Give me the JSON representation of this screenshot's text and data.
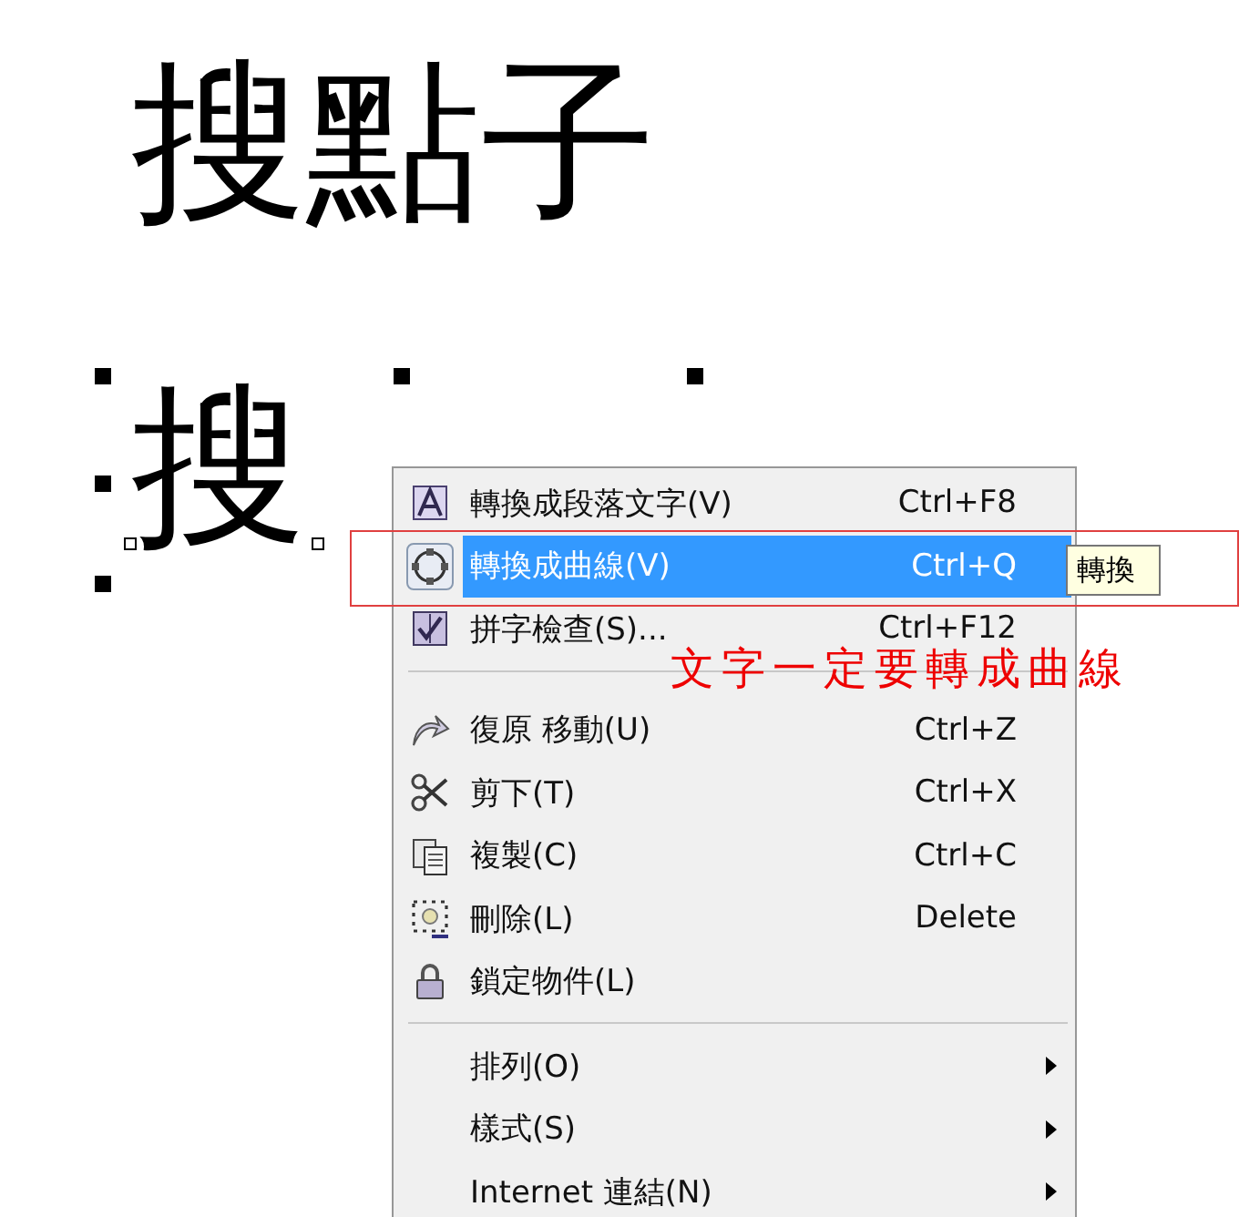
{
  "canvas_texts": [
    "搜點子",
    "搜"
  ],
  "context_menu": {
    "items": [
      {
        "kind": "item",
        "label": "轉換成段落文字(V)",
        "shortcut": "Ctrl+F8",
        "selected": false
      },
      {
        "kind": "item",
        "label": "轉換成曲線(V)",
        "shortcut": "Ctrl+Q",
        "selected": true
      },
      {
        "kind": "item",
        "label": "拼字檢查(S)...",
        "shortcut": "Ctrl+F12",
        "selected": false
      },
      {
        "kind": "separator"
      },
      {
        "kind": "item",
        "label": "復原 移動(U)",
        "shortcut": "Ctrl+Z",
        "selected": false
      },
      {
        "kind": "item",
        "label": "剪下(T)",
        "shortcut": "Ctrl+X",
        "selected": false
      },
      {
        "kind": "item",
        "label": "複製(C)",
        "shortcut": "Ctrl+C",
        "selected": false
      },
      {
        "kind": "item",
        "label": "刪除(L)",
        "shortcut": "Delete",
        "selected": false
      },
      {
        "kind": "item",
        "label": "鎖定物件(L)",
        "selected": false
      },
      {
        "kind": "separator"
      },
      {
        "kind": "submenu",
        "label": "排列(O)",
        "selected": false
      },
      {
        "kind": "submenu",
        "label": "樣式(S)",
        "selected": false
      },
      {
        "kind": "submenu",
        "label": "Internet 連結(N)",
        "selected": false
      }
    ]
  },
  "tooltip": "轉換",
  "annotation": "文字一定要轉成曲線"
}
